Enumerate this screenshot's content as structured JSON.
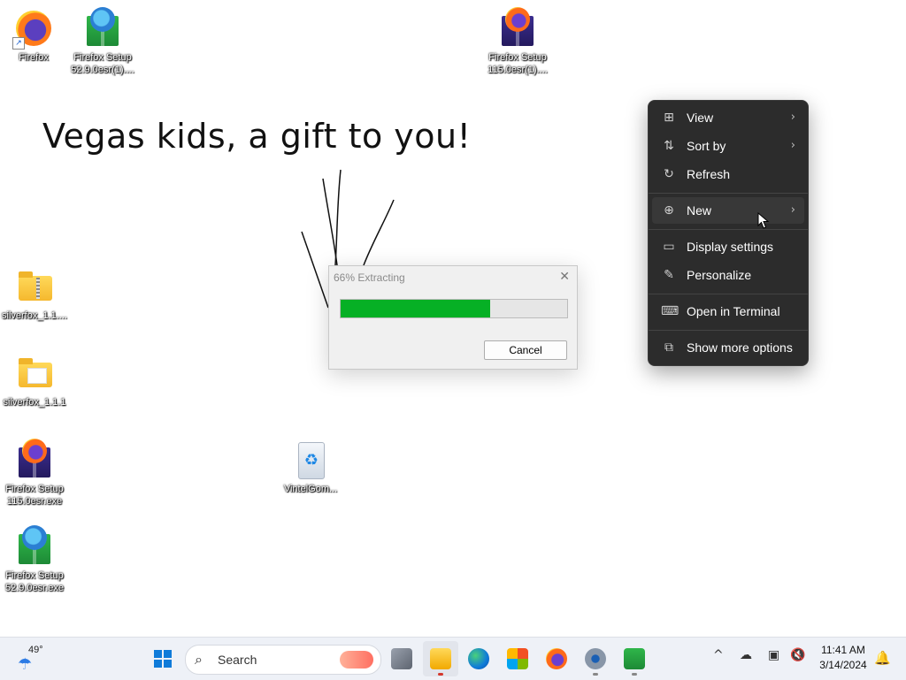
{
  "desktop": {
    "icons": [
      {
        "label": "Firefox"
      },
      {
        "label": "Firefox Setup 52.9.0esr(1)...."
      },
      {
        "label": "Firefox Setup 115.0esr(1)...."
      },
      {
        "label": "silverfox_1.1...."
      },
      {
        "label": "silverfox_1.1.1"
      },
      {
        "label": "Firefox Setup 115.0esr.exe"
      },
      {
        "label": "VintelGom..."
      },
      {
        "label": "Firefox Setup 52.9.0esr.exe"
      }
    ],
    "headline": "Vegas kids, a gift to you!"
  },
  "dialog": {
    "title": "66% Extracting",
    "close_glyph": "✕",
    "progress": 0.66,
    "cancel_label": "Cancel",
    "progress_color": "#06b025"
  },
  "context_menu": {
    "items": [
      {
        "label": "View",
        "icon": "grid-icon",
        "glyph": "⊞",
        "submenu": true
      },
      {
        "label": "Sort by",
        "icon": "sort-icon",
        "glyph": "⇅",
        "submenu": true
      },
      {
        "label": "Refresh",
        "icon": "refresh-icon",
        "glyph": "↻",
        "submenu": false
      },
      {
        "label": "New",
        "icon": "plus-circle-icon",
        "glyph": "⊕",
        "submenu": true
      },
      {
        "label": "Display settings",
        "icon": "display-icon",
        "glyph": "▭",
        "submenu": false
      },
      {
        "label": "Personalize",
        "icon": "pen-icon",
        "glyph": "✎",
        "submenu": false
      },
      {
        "label": "Open in Terminal",
        "icon": "terminal-icon",
        "glyph": "⌨",
        "submenu": false
      },
      {
        "label": "Show more options",
        "icon": "expand-icon",
        "glyph": "⧉",
        "submenu": false
      }
    ],
    "submenu_glyph": "›",
    "background": "#2c2c2c"
  },
  "taskbar": {
    "weather": {
      "temp": "49°",
      "icon": "umbrella-icon",
      "glyph": "☂"
    },
    "search_label": "Search",
    "search_glyph": "⌕",
    "tray": {
      "chevron": "^",
      "cloud": "☁",
      "network": "▣",
      "volume": "🔇"
    },
    "clock": {
      "time": "11:41 AM",
      "date": "3/14/2024"
    },
    "bell_glyph": "🔔",
    "accent": "#0f7bd9"
  }
}
